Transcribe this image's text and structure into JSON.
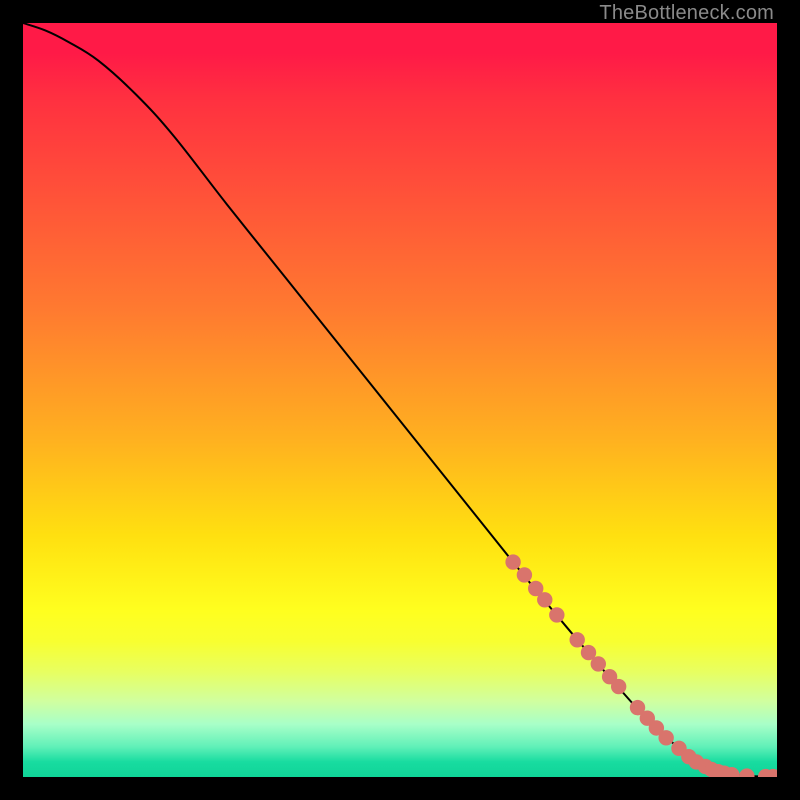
{
  "watermark": "TheBottleneck.com",
  "colors": {
    "curve": "#000000",
    "dot_fill": "#d9746c",
    "dot_stroke": "#d9746c",
    "background_black": "#000000"
  },
  "chart_data": {
    "type": "line",
    "title": "",
    "xlabel": "",
    "ylabel": "",
    "xlim": [
      0,
      100
    ],
    "ylim": [
      0,
      100
    ],
    "grid": false,
    "series": [
      {
        "name": "curve",
        "x": [
          0,
          3,
          6,
          10,
          15,
          20,
          27,
          35,
          45,
          55,
          65,
          72,
          78,
          82,
          85,
          87.5,
          89,
          91,
          93,
          96,
          100
        ],
        "y": [
          100,
          99,
          97.5,
          95,
          90.5,
          85,
          76,
          66,
          53.5,
          41,
          28.5,
          20,
          13,
          8.5,
          5.5,
          3.5,
          2.3,
          1.3,
          0.6,
          0.15,
          0.05
        ]
      }
    ],
    "dots": {
      "name": "highlighted-points",
      "points": [
        {
          "x": 65.0,
          "y": 28.5
        },
        {
          "x": 66.5,
          "y": 26.8
        },
        {
          "x": 68.0,
          "y": 25.0
        },
        {
          "x": 69.2,
          "y": 23.5
        },
        {
          "x": 70.8,
          "y": 21.5
        },
        {
          "x": 73.5,
          "y": 18.2
        },
        {
          "x": 75.0,
          "y": 16.5
        },
        {
          "x": 76.3,
          "y": 15.0
        },
        {
          "x": 77.8,
          "y": 13.3
        },
        {
          "x": 79.0,
          "y": 12.0
        },
        {
          "x": 81.5,
          "y": 9.2
        },
        {
          "x": 82.8,
          "y": 7.8
        },
        {
          "x": 84.0,
          "y": 6.5
        },
        {
          "x": 85.3,
          "y": 5.2
        },
        {
          "x": 87.0,
          "y": 3.8
        },
        {
          "x": 88.3,
          "y": 2.7
        },
        {
          "x": 89.3,
          "y": 2.0
        },
        {
          "x": 90.5,
          "y": 1.4
        },
        {
          "x": 91.3,
          "y": 1.0
        },
        {
          "x": 92.2,
          "y": 0.7
        },
        {
          "x": 93.0,
          "y": 0.5
        },
        {
          "x": 94.0,
          "y": 0.3
        },
        {
          "x": 96.0,
          "y": 0.13
        },
        {
          "x": 98.5,
          "y": 0.06
        },
        {
          "x": 99.5,
          "y": 0.05
        }
      ]
    }
  }
}
